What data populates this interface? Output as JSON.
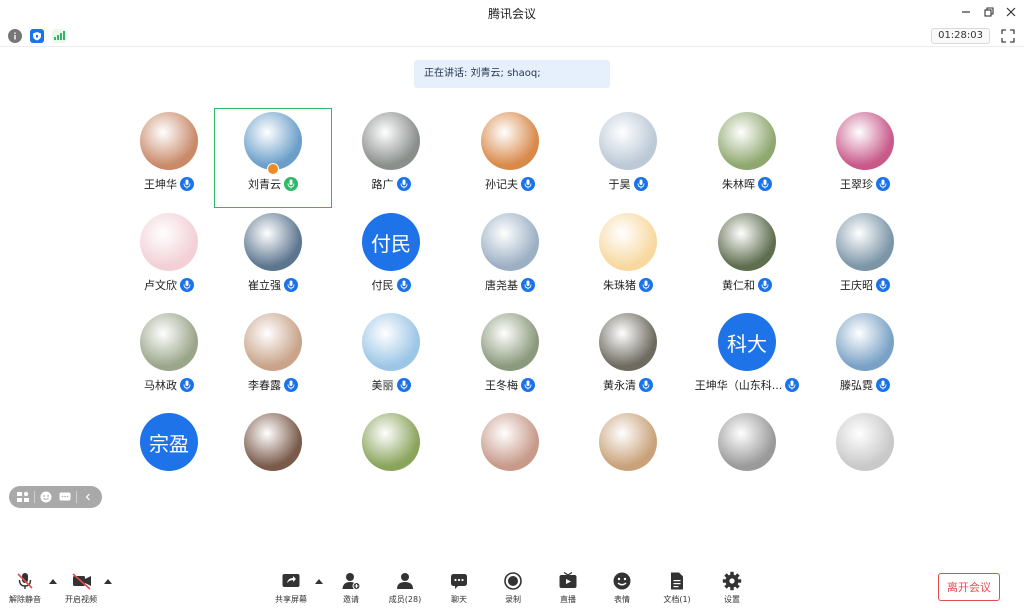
{
  "window": {
    "title": "腾讯会议"
  },
  "infobar": {
    "timer": "01:28:03"
  },
  "speaking": {
    "text": "正在讲话: 刘青云; shaoq;"
  },
  "participants": [
    {
      "name": "王坤华",
      "mic": "on",
      "color": "#c98a6a"
    },
    {
      "name": "刘青云",
      "mic": "speaking",
      "color": "#6b9fc9",
      "active": true,
      "host": true
    },
    {
      "name": "路广",
      "mic": "on",
      "color": "#8a8f8c"
    },
    {
      "name": "孙记夫",
      "mic": "on",
      "color": "#d88a4a"
    },
    {
      "name": "于昊",
      "mic": "on",
      "color": "#bcc9d6"
    },
    {
      "name": "朱林晖",
      "mic": "on",
      "color": "#8fa86f"
    },
    {
      "name": "王翠珍",
      "mic": "on",
      "color": "#c85a8a"
    },
    {
      "name": "卢文欣",
      "mic": "on",
      "color": "#f2d0d6"
    },
    {
      "name": "崔立强",
      "mic": "on",
      "color": "#5d7690"
    },
    {
      "name": "付民",
      "mic": "on",
      "initials": "付民",
      "color": "#1e73e8"
    },
    {
      "name": "唐尧基",
      "mic": "on",
      "color": "#9cb0c4"
    },
    {
      "name": "朱珠猪",
      "mic": "on",
      "color": "#f7d9a0"
    },
    {
      "name": "黄仁和",
      "mic": "on",
      "color": "#5f6e4f"
    },
    {
      "name": "王庆昭",
      "mic": "on",
      "color": "#7c96a8"
    },
    {
      "name": "马林政",
      "mic": "on",
      "color": "#9aa68a"
    },
    {
      "name": "李春露",
      "mic": "on",
      "color": "#c9a48a"
    },
    {
      "name": "美丽",
      "mic": "on",
      "color": "#9cc6e6"
    },
    {
      "name": "王冬梅",
      "mic": "on",
      "color": "#8b9a7c"
    },
    {
      "name": "黄永清",
      "mic": "on",
      "color": "#6e6a60"
    },
    {
      "name": "王坤华（山东科...",
      "mic": "on",
      "initials": "科大",
      "color": "#1e73e8"
    },
    {
      "name": "滕弘霓",
      "mic": "on",
      "color": "#7aa2c6"
    },
    {
      "name": "",
      "mic": "none",
      "initials": "宗盈",
      "color": "#1e73e8"
    },
    {
      "name": "",
      "mic": "none",
      "color": "#7a5a4a"
    },
    {
      "name": "",
      "mic": "none",
      "color": "#8aa45c"
    },
    {
      "name": "",
      "mic": "none",
      "color": "#c79a8a"
    },
    {
      "name": "",
      "mic": "none",
      "color": "#c9a27a"
    },
    {
      "name": "",
      "mic": "none",
      "color": "#9a9a9a"
    },
    {
      "name": "",
      "mic": "none",
      "color": "#c9c9c9"
    }
  ],
  "toolbar": {
    "unmute": "解除静音",
    "start_video": "开启视频",
    "share_screen": "共享屏幕",
    "invite": "邀请",
    "members": "成员(28)",
    "chat": "聊天",
    "record": "录制",
    "live": "直播",
    "emoji": "表情",
    "docs": "文档(1)",
    "settings": "设置",
    "leave": "离开会议"
  }
}
